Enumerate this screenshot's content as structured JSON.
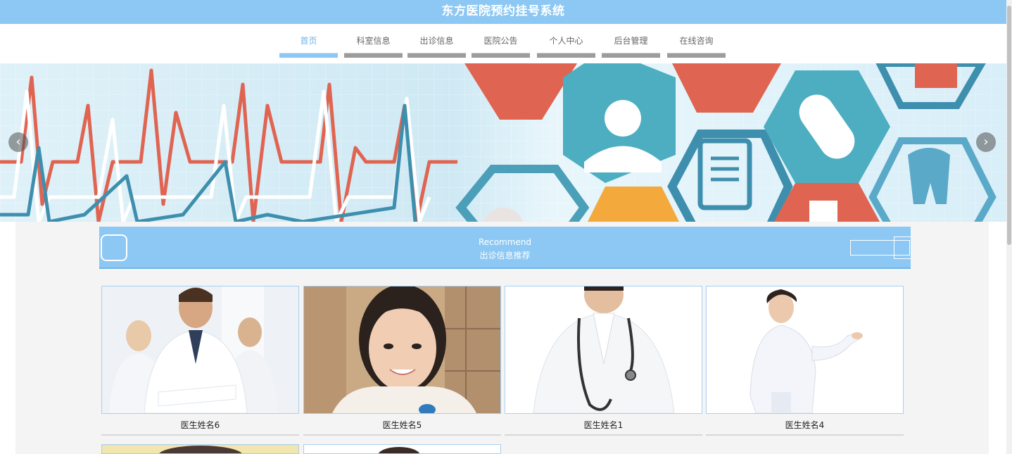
{
  "header": {
    "title": "东方医院预约挂号系统"
  },
  "nav": {
    "items": [
      {
        "label": "首页",
        "active": true
      },
      {
        "label": "科室信息",
        "active": false
      },
      {
        "label": "出诊信息",
        "active": false
      },
      {
        "label": "医院公告",
        "active": false
      },
      {
        "label": "个人中心",
        "active": false
      },
      {
        "label": "后台管理",
        "active": false
      },
      {
        "label": "在线咨询",
        "active": false
      }
    ]
  },
  "banner": {
    "prev_icon": "chevron-left-icon",
    "next_icon": "chevron-right-icon",
    "prev_glyph": "‹",
    "next_glyph": "›"
  },
  "recommend": {
    "title_en": "Recommend",
    "title_cn": "出诊信息推荐"
  },
  "doctors": [
    {
      "name": "医生姓名6"
    },
    {
      "name": "医生姓名5"
    },
    {
      "name": "医生姓名1"
    },
    {
      "name": "医生姓名4"
    }
  ],
  "colors": {
    "accent": "#8cc8f3",
    "red": "#e06452",
    "teal": "#4c9fb9",
    "orange": "#f3a93b"
  }
}
